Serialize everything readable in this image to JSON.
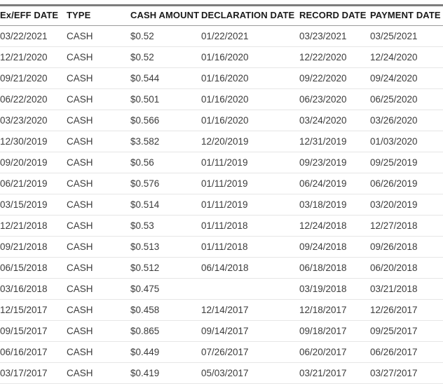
{
  "table": {
    "name": "dividend-history-table",
    "columns": [
      {
        "key": "ex_eff_date",
        "label": "Ex/EFF DATE"
      },
      {
        "key": "type",
        "label": "TYPE"
      },
      {
        "key": "cash_amount",
        "label": "CASH AMOUNT"
      },
      {
        "key": "declaration_date",
        "label": "DECLARATION DATE"
      },
      {
        "key": "record_date",
        "label": "RECORD DATE"
      },
      {
        "key": "payment_date",
        "label": "PAYMENT DATE"
      }
    ],
    "rows": [
      {
        "ex_eff_date": "03/22/2021",
        "type": "CASH",
        "cash_amount": "$0.52",
        "declaration_date": "01/22/2021",
        "record_date": "03/23/2021",
        "payment_date": "03/25/2021"
      },
      {
        "ex_eff_date": "12/21/2020",
        "type": "CASH",
        "cash_amount": "$0.52",
        "declaration_date": "01/16/2020",
        "record_date": "12/22/2020",
        "payment_date": "12/24/2020"
      },
      {
        "ex_eff_date": "09/21/2020",
        "type": "CASH",
        "cash_amount": "$0.544",
        "declaration_date": "01/16/2020",
        "record_date": "09/22/2020",
        "payment_date": "09/24/2020"
      },
      {
        "ex_eff_date": "06/22/2020",
        "type": "CASH",
        "cash_amount": "$0.501",
        "declaration_date": "01/16/2020",
        "record_date": "06/23/2020",
        "payment_date": "06/25/2020"
      },
      {
        "ex_eff_date": "03/23/2020",
        "type": "CASH",
        "cash_amount": "$0.566",
        "declaration_date": "01/16/2020",
        "record_date": "03/24/2020",
        "payment_date": "03/26/2020"
      },
      {
        "ex_eff_date": "12/30/2019",
        "type": "CASH",
        "cash_amount": "$3.582",
        "declaration_date": "12/20/2019",
        "record_date": "12/31/2019",
        "payment_date": "01/03/2020"
      },
      {
        "ex_eff_date": "09/20/2019",
        "type": "CASH",
        "cash_amount": "$0.56",
        "declaration_date": "01/11/2019",
        "record_date": "09/23/2019",
        "payment_date": "09/25/2019"
      },
      {
        "ex_eff_date": "06/21/2019",
        "type": "CASH",
        "cash_amount": "$0.576",
        "declaration_date": "01/11/2019",
        "record_date": "06/24/2019",
        "payment_date": "06/26/2019"
      },
      {
        "ex_eff_date": "03/15/2019",
        "type": "CASH",
        "cash_amount": "$0.514",
        "declaration_date": "01/11/2019",
        "record_date": "03/18/2019",
        "payment_date": "03/20/2019"
      },
      {
        "ex_eff_date": "12/21/2018",
        "type": "CASH",
        "cash_amount": "$0.53",
        "declaration_date": "01/11/2018",
        "record_date": "12/24/2018",
        "payment_date": "12/27/2018"
      },
      {
        "ex_eff_date": "09/21/2018",
        "type": "CASH",
        "cash_amount": "$0.513",
        "declaration_date": "01/11/2018",
        "record_date": "09/24/2018",
        "payment_date": "09/26/2018"
      },
      {
        "ex_eff_date": "06/15/2018",
        "type": "CASH",
        "cash_amount": "$0.512",
        "declaration_date": "06/14/2018",
        "record_date": "06/18/2018",
        "payment_date": "06/20/2018"
      },
      {
        "ex_eff_date": "03/16/2018",
        "type": "CASH",
        "cash_amount": "$0.475",
        "declaration_date": "",
        "record_date": "03/19/2018",
        "payment_date": "03/21/2018"
      },
      {
        "ex_eff_date": "12/15/2017",
        "type": "CASH",
        "cash_amount": "$0.458",
        "declaration_date": "12/14/2017",
        "record_date": "12/18/2017",
        "payment_date": "12/26/2017"
      },
      {
        "ex_eff_date": "09/15/2017",
        "type": "CASH",
        "cash_amount": "$0.865",
        "declaration_date": "09/14/2017",
        "record_date": "09/18/2017",
        "payment_date": "09/25/2017"
      },
      {
        "ex_eff_date": "06/16/2017",
        "type": "CASH",
        "cash_amount": "$0.449",
        "declaration_date": "07/26/2017",
        "record_date": "06/20/2017",
        "payment_date": "06/26/2017"
      },
      {
        "ex_eff_date": "03/17/2017",
        "type": "CASH",
        "cash_amount": "$0.419",
        "declaration_date": "05/03/2017",
        "record_date": "03/21/2017",
        "payment_date": "03/27/2017"
      }
    ]
  },
  "style": {
    "header_text_color": "#1a1a1a",
    "body_text_color": "#3c3c3c",
    "top_rule_color": "#7d7d7d",
    "header_rule_color": "#9a9a9a",
    "row_rule_color": "#e6e6e6",
    "background_color": "#ffffff"
  }
}
